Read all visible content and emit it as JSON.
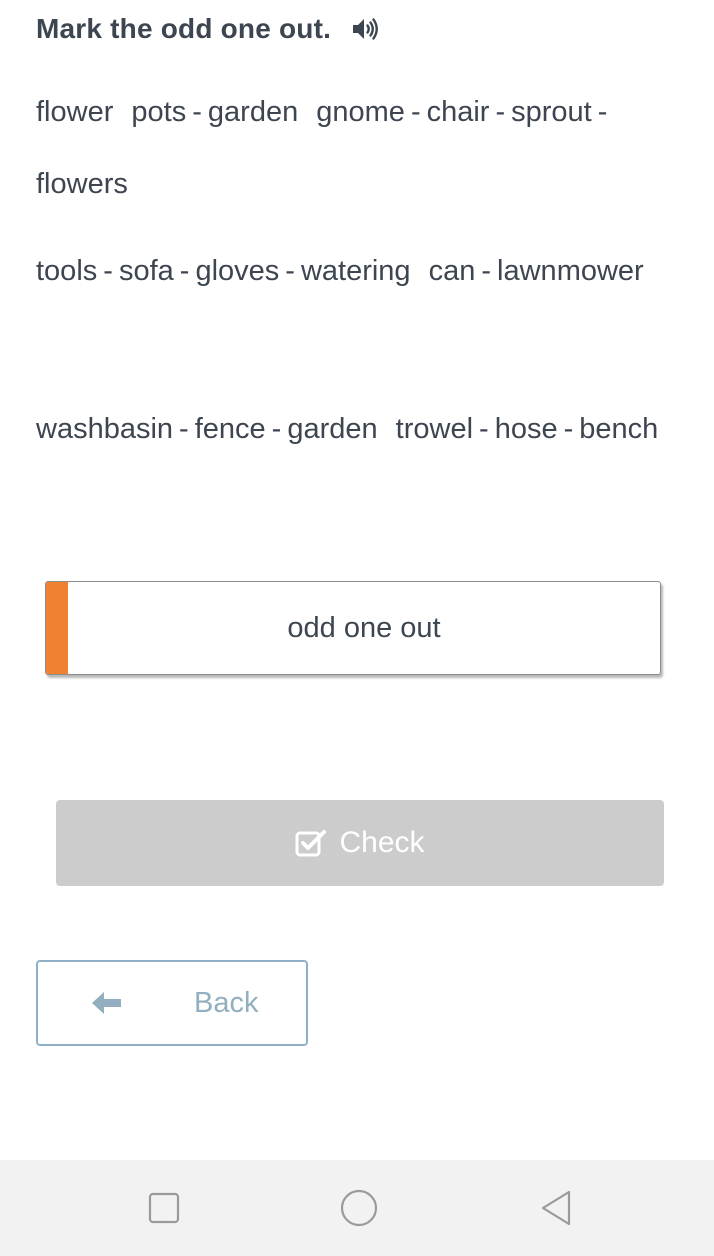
{
  "header": {
    "title": "Mark the odd one out.",
    "audio_icon": "speaker-icon"
  },
  "exercises": [
    {
      "words": [
        "flower pots",
        "garden gnome",
        "chair",
        "sprout",
        "flowers"
      ]
    },
    {
      "words": [
        "tools",
        "sofa",
        "gloves",
        "watering can",
        "lawnmower"
      ]
    },
    {
      "words": [
        "washbasin",
        "fence",
        "garden trowel",
        "hose",
        "bench"
      ]
    }
  ],
  "separator": "-",
  "answer": {
    "label": "odd one out",
    "accent_color": "#f08132"
  },
  "check_button": {
    "label": "Check",
    "icon": "check-square-icon",
    "color": "#cccccc"
  },
  "back_button": {
    "label": "Back",
    "icon": "arrow-left-icon",
    "color": "#8fb1c8"
  },
  "navigation": {
    "icons": [
      "square-icon",
      "circle-icon",
      "triangle-back-icon"
    ]
  }
}
